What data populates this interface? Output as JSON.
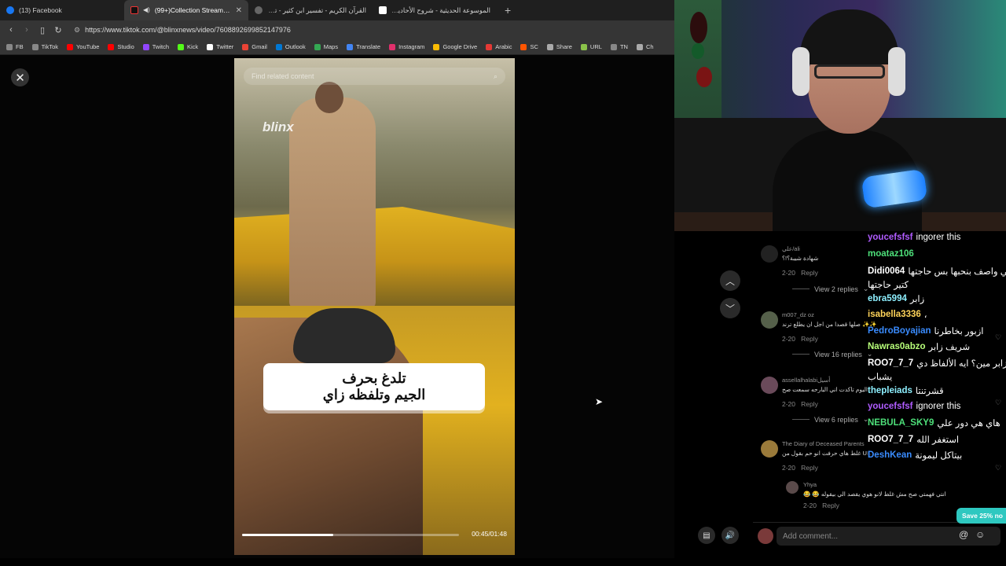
{
  "browser": {
    "tabs": [
      {
        "title": "(13) Facebook",
        "color": "#1877f2",
        "active": false
      },
      {
        "title": "(99+)Collection Stream creat",
        "color": "#111111",
        "active": true
      },
      {
        "title": "القرآن الكريم - تفسير ابن كثير - تفسير",
        "color": "#666666",
        "active": false
      },
      {
        "title": "الموسوعة الحديثية - شروح الأحاديث - از",
        "color": "#ffffff",
        "active": false
      }
    ],
    "url": "https://www.tiktok.com/@blinxnews/video/7608892699852147976",
    "bookmarks": [
      {
        "label": "FB",
        "color": "#888888"
      },
      {
        "label": "TikTok",
        "color": "#888888"
      },
      {
        "label": "YouTube",
        "color": "#ff0000"
      },
      {
        "label": "Studio",
        "color": "#ff0000"
      },
      {
        "label": "Twitch",
        "color": "#9146ff"
      },
      {
        "label": "Kick",
        "color": "#53fc18"
      },
      {
        "label": "Twitter",
        "color": "#ffffff"
      },
      {
        "label": "Gmail",
        "color": "#ea4335"
      },
      {
        "label": "Outlook",
        "color": "#0078d4"
      },
      {
        "label": "Maps",
        "color": "#34a853"
      },
      {
        "label": "Translate",
        "color": "#4285f4"
      },
      {
        "label": "Instagram",
        "color": "#e1306c"
      },
      {
        "label": "Google Drive",
        "color": "#fbbc04"
      },
      {
        "label": "Arabic",
        "color": "#e53935"
      },
      {
        "label": "SC",
        "color": "#ff5500"
      },
      {
        "label": "Share",
        "color": "#aaaaaa"
      },
      {
        "label": "URL",
        "color": "#8bc34a"
      },
      {
        "label": "TN",
        "color": "#888888"
      },
      {
        "label": "Ch",
        "color": "#aaaaaa"
      }
    ]
  },
  "video": {
    "search_placeholder": "Find related content",
    "watermark": "blinx",
    "caption_line1": "تلدغ بحرف",
    "caption_line2": "الجيم وتلفظه زاي",
    "progress": 0.42,
    "time": "00:45/01:48"
  },
  "comments": [
    {
      "user": "علي/ali",
      "text": "شهادة شيبة؟!؟",
      "date": "2-20",
      "reply": "Reply",
      "replies": "View 2 replies",
      "avatar": "#222222"
    },
    {
      "user": "m007_dz oz",
      "text": "صلها قصدا من اجل ان يطلع ترند ✨✨",
      "date": "2-20",
      "reply": "Reply",
      "replies": "View 16 replies",
      "avatar": "#55604a"
    },
    {
      "user": "assellalhalabiأسيل",
      "text": "اليوم تاكدت اني البارحه سمعت صح",
      "date": "2-20",
      "reply": "Reply",
      "replies": "View 6 replies",
      "avatar": "#6a4a5a"
    },
    {
      "user": "The Diary of Deceased Parents",
      "text": "غلط هاي حرفت انو حم بقول من UK.",
      "date": "2-20",
      "reply": "Reply",
      "replies": "",
      "avatar": "#9a7a3a"
    }
  ],
  "nested_reply": {
    "user": "Yhya",
    "text": "😂 😂 انتي فهمتي صح مش غلط لانو هوي يقصد الي بيقوله",
    "date": "2-20",
    "reply": "Reply"
  },
  "comment_bar": {
    "placeholder": "Add comment..."
  },
  "save_badge": "Save 25% no",
  "chat": [
    {
      "user": "youcefsfsf",
      "msg": "ingorer this",
      "color": "#b05cff"
    },
    {
      "user": "moataz106",
      "msg": "",
      "color": "#4ee07a"
    },
    {
      "user": "Didi0064",
      "msg": "يعني واصف بنحبها بس حاجتها",
      "color": "#ffffff"
    },
    {
      "user": "",
      "msg": "كتير حاجتها",
      "color": "#ffffff"
    },
    {
      "user": "ebra5994",
      "msg": "زابر",
      "color": "#8ef0ff"
    },
    {
      "user": "isabella3336",
      "msg": "،",
      "color": "#ffd45a"
    },
    {
      "user": "PedroBoyajian",
      "msg": "ازبور بخاطرنا",
      "color": "#3a8cff"
    },
    {
      "user": "Nawras0abzo",
      "msg": "شريف زابر",
      "color": "#b8ff7a"
    },
    {
      "user": "ROO7_7_7",
      "msg": "زابر مين؟ ايه الألفاظ دي",
      "color": "#ffffff"
    },
    {
      "user": "",
      "msg": "يشباب",
      "color": "#ffffff"
    },
    {
      "user": "thepleiads",
      "msg": "قشرتنتا",
      "color": "#8ef0ff"
    },
    {
      "user": "youcefsfsf",
      "msg": "ignorer this",
      "color": "#b05cff"
    },
    {
      "user": "NEBULA_SKY9",
      "msg": "هاي هي دور علي",
      "color": "#4ee07a"
    },
    {
      "user": "ROO7_7_7",
      "msg": "استغفر الله",
      "color": "#ffffff"
    },
    {
      "user": "DeshKean",
      "msg": "بيتاكل ليمونة",
      "color": "#3a8cff"
    }
  ]
}
